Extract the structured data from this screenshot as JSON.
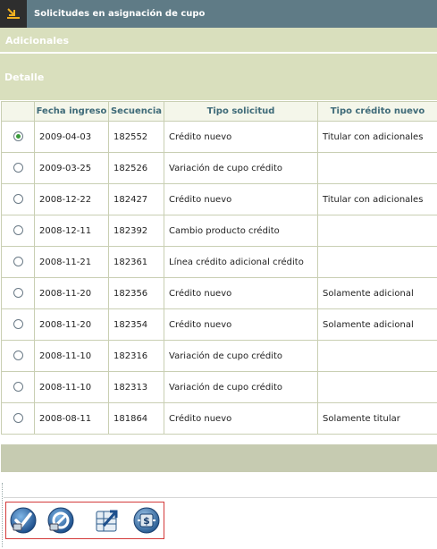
{
  "window": {
    "title": "Solicitudes en asignación de cupo"
  },
  "sections": {
    "adicionales": "Adicionales",
    "detalle": "Detalle"
  },
  "table": {
    "columns": [
      "Fecha ingreso",
      "Secuencia",
      "Tipo solicitud",
      "Tipo crédito nuevo"
    ],
    "rows": [
      {
        "selected": true,
        "fecha": "2009-04-03",
        "secuencia": "182552",
        "tipo": "Crédito nuevo",
        "credito": "Titular con adicionales"
      },
      {
        "selected": false,
        "fecha": "2009-03-25",
        "secuencia": "182526",
        "tipo": "Variación de cupo crédito",
        "credito": ""
      },
      {
        "selected": false,
        "fecha": "2008-12-22",
        "secuencia": "182427",
        "tipo": "Crédito nuevo",
        "credito": "Titular con adicionales"
      },
      {
        "selected": false,
        "fecha": "2008-12-11",
        "secuencia": "182392",
        "tipo": "Cambio producto crédito",
        "credito": ""
      },
      {
        "selected": false,
        "fecha": "2008-11-21",
        "secuencia": "182361",
        "tipo": "Línea crédito adicional crédito",
        "credito": ""
      },
      {
        "selected": false,
        "fecha": "2008-11-20",
        "secuencia": "182356",
        "tipo": "Crédito nuevo",
        "credito": "Solamente adicional"
      },
      {
        "selected": false,
        "fecha": "2008-11-20",
        "secuencia": "182354",
        "tipo": "Crédito nuevo",
        "credito": "Solamente adicional"
      },
      {
        "selected": false,
        "fecha": "2008-11-10",
        "secuencia": "182316",
        "tipo": "Variación de cupo crédito",
        "credito": ""
      },
      {
        "selected": false,
        "fecha": "2008-11-10",
        "secuencia": "182313",
        "tipo": "Variación de cupo crédito",
        "credito": ""
      },
      {
        "selected": false,
        "fecha": "2008-08-11",
        "secuencia": "181864",
        "tipo": "Crédito nuevo",
        "credito": "Solamente titular"
      }
    ]
  },
  "toolbar": {
    "buttons": [
      {
        "icon": "accept-icon"
      },
      {
        "icon": "reject-icon"
      },
      {
        "icon": "export-icon"
      },
      {
        "icon": "quota-money-icon"
      }
    ]
  },
  "colors": {
    "titlebar": "#5f7b86",
    "band": "#d9dfbd",
    "header_text": "#3e6a78",
    "footer_band": "#c6cbb1",
    "toolbar_border": "#d43a3a"
  }
}
